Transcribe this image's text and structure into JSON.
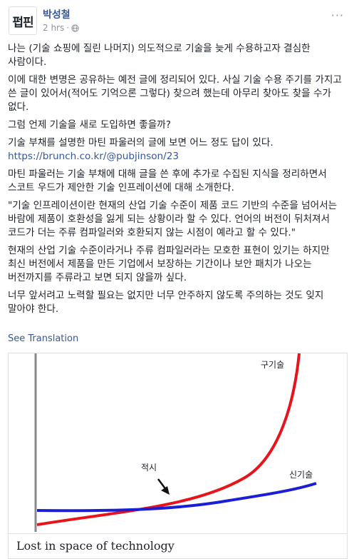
{
  "post": {
    "avatar_text": "펍핀",
    "author": "박성철",
    "time": "2 hrs",
    "separator": "·",
    "more": "···",
    "paragraphs": [
      "나는 (기술 쇼핑에 질린 나머지) 의도적으로 기술을 늦게 수용하고자 결심한 사람이다.",
      "이에 대한 변명은 공유하는 예전 글에 정리되어 있다. 사실 기술 수용 주기를 가지고 쓴 글이 있어서(적어도 기억으론 그렇다) 찾으려 했는데 아무리 찾아도 찾을 수가 없다.",
      "그럼 언제 기술을 새로 도입하면 좋을까?",
      "기술 부채를 설명한 마틴 파울러의 글에 보면 어느 정도 답이 있다.",
      "마틴 파울러는 기술 부채에 대해 글을 쓴 후에 추가로 수집된 지식을 정리하면서 스코트 우드가 제안한 기술 인프레이션에 대해 소개한다.",
      "\"기술 인프레이션이란 현재의 산업 기술 수준이 제품 코드 기반의 수준을 넘어서는 바람에 제품이 호환성을 잃게 되는 상황이라 할 수 있다. 언어의 버전이 뒤처져서 코드가 더는 주류 컴파일러와 호환되지 않는 시점이 예라고 할 수 있다.\"",
      "현재의 산업 기술 수준이라거나 주류 컴파일러라는 모호한 표현이 있기는 하지만 최신 버전에서 제품을 만든 기업에서 보장하는 기간이나 보안 패치가 나오는 버전까지를 주류라고 보면 되지 않을까 싶다.",
      "너무 앞서려고 노력할 필요는 없지만 너무 안주하지 않도록 주의하는 것도 잊지 말아야 한다."
    ],
    "link": "https://brunch.co.kr/@pubjinson/23",
    "see_translation": "See Translation"
  },
  "attachment": {
    "caption_title": "Lost in space of technology",
    "label_old": "구기술",
    "label_new": "신기술",
    "label_timing": "적시"
  },
  "colors": {
    "old_tech": "#e8141b",
    "new_tech": "#1a1fd6",
    "link": "#365899"
  }
}
